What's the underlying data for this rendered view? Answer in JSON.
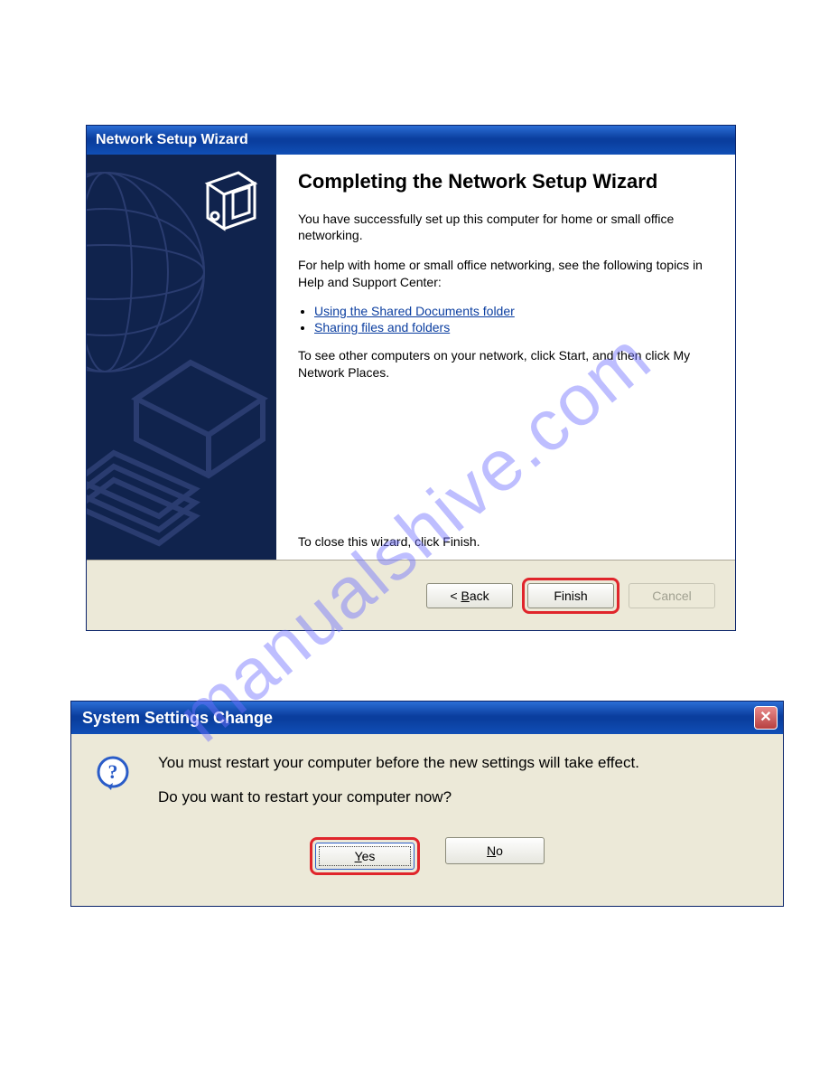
{
  "watermark": "manualshive.com",
  "wizard": {
    "title": "Network Setup Wizard",
    "heading": "Completing the Network Setup Wizard",
    "para1": "You have successfully set up this computer for home or small office networking.",
    "para2": "For help with home or small office networking, see the following topics in Help and Support Center:",
    "link1": "Using the Shared Documents folder",
    "link2": "Sharing files and folders",
    "para3": "To see other computers on your network, click Start, and then click My Network Places.",
    "close_hint": "To close this wizard, click Finish.",
    "buttons": {
      "back_prefix": "< ",
      "back_letter": "B",
      "back_rest": "ack",
      "finish": "Finish",
      "cancel": "Cancel"
    }
  },
  "msgbox": {
    "title": "System Settings Change",
    "line1": "You must restart your computer before the new settings will take effect.",
    "line2": "Do you want to restart your computer now?",
    "buttons": {
      "yes_letter": "Y",
      "yes_rest": "es",
      "no_letter": "N",
      "no_rest": "o"
    }
  }
}
